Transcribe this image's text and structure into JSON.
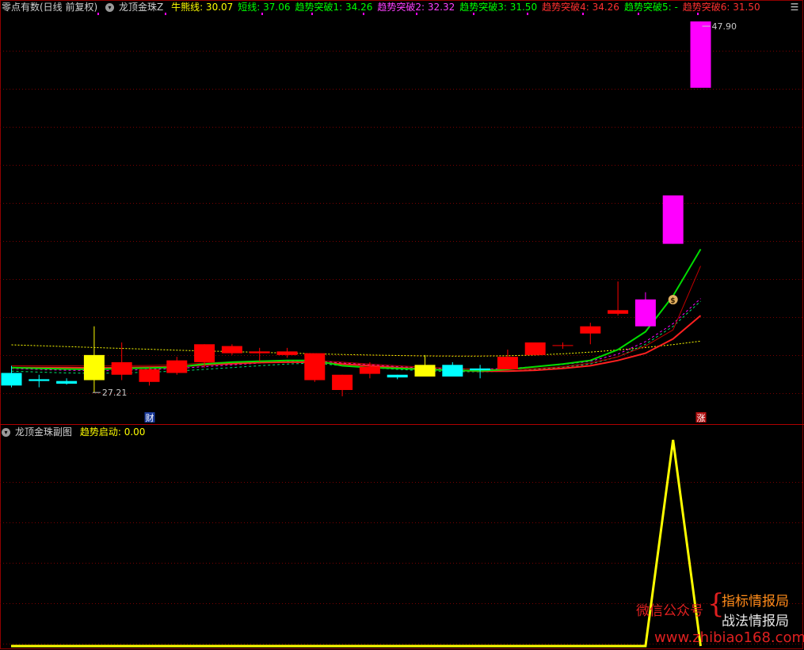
{
  "header": {
    "title": "零点有数(日线 前复权)",
    "indicator_name": "龙顶金珠Z",
    "items": [
      {
        "label": "牛熊线",
        "value": "30.07",
        "color": "#ffff00"
      },
      {
        "label": "短线",
        "value": "37.06",
        "color": "#00ff00"
      },
      {
        "label": "趋势突破1",
        "value": "34.26",
        "color": "#00ff00"
      },
      {
        "label": "趋势突破2",
        "value": "32.32",
        "color": "#ff40ff"
      },
      {
        "label": "趋势突破3",
        "value": "31.50",
        "color": "#00ff00"
      },
      {
        "label": "趋势突破4",
        "value": "34.26",
        "color": "#ff3030"
      },
      {
        "label": "趋势突破5",
        "value": "-",
        "color": "#00ff00"
      },
      {
        "label": "趋势突破6",
        "value": "31.50",
        "color": "#ff3030"
      }
    ]
  },
  "subpanel": {
    "indicator_name": "龙顶金珠副图",
    "items": [
      {
        "label": "趋势启动",
        "value": "0.00",
        "color": "#ffff00"
      }
    ]
  },
  "price_labels": {
    "high": "47.90",
    "low": "27.21"
  },
  "markers": {
    "finance": "财",
    "limit_up": "涨",
    "money": "$"
  },
  "watermark": {
    "left": "微信公众号",
    "right_top": "指标情报局",
    "right_bottom": "战法情报局",
    "url": "www.zhibiao168.com"
  },
  "colors": {
    "up": "#ff0000",
    "down": "#00ffff",
    "flat_yellow": "#ffff00",
    "magenta": "#ff00ff",
    "grid": "#7a0000",
    "bull_bear_line": "#ffff00",
    "short_line": "#00ff00"
  },
  "chart_data": {
    "type": "candlestick",
    "candles": [
      {
        "o": 28.3,
        "h": 28.7,
        "l": 27.5,
        "c": 27.6,
        "color": "cyan"
      },
      {
        "o": 27.95,
        "h": 28.2,
        "l": 27.5,
        "c": 27.85,
        "color": "cyan"
      },
      {
        "o": 27.85,
        "h": 28.0,
        "l": 27.65,
        "c": 27.7,
        "color": "cyan"
      },
      {
        "o": 27.9,
        "h": 30.9,
        "l": 27.21,
        "c": 29.3,
        "color": "yellow"
      },
      {
        "o": 28.2,
        "h": 30.0,
        "l": 27.9,
        "c": 28.9,
        "color": "red"
      },
      {
        "o": 27.8,
        "h": 28.6,
        "l": 27.6,
        "c": 28.5,
        "color": "red"
      },
      {
        "o": 28.3,
        "h": 29.2,
        "l": 28.2,
        "c": 29.0,
        "color": "red"
      },
      {
        "o": 28.9,
        "h": 29.9,
        "l": 28.6,
        "c": 29.9,
        "color": "red"
      },
      {
        "o": 29.4,
        "h": 29.9,
        "l": 29.3,
        "c": 29.8,
        "color": "red"
      },
      {
        "o": 29.4,
        "h": 29.7,
        "l": 28.95,
        "c": 29.5,
        "color": "red"
      },
      {
        "o": 29.3,
        "h": 29.7,
        "l": 29.15,
        "c": 29.5,
        "color": "red"
      },
      {
        "o": 27.9,
        "h": 29.3,
        "l": 27.8,
        "c": 29.4,
        "color": "red"
      },
      {
        "o": 27.35,
        "h": 28.2,
        "l": 27.0,
        "c": 28.2,
        "color": "red"
      },
      {
        "o": 28.25,
        "h": 28.9,
        "l": 28.0,
        "c": 28.65,
        "color": "red"
      },
      {
        "o": 28.2,
        "h": 28.2,
        "l": 27.95,
        "c": 28.05,
        "color": "cyan"
      },
      {
        "o": 28.75,
        "h": 29.3,
        "l": 28.2,
        "c": 28.1,
        "color": "yellow"
      },
      {
        "o": 28.1,
        "h": 28.9,
        "l": 28.1,
        "c": 28.75,
        "color": "cyan"
      },
      {
        "o": 28.55,
        "h": 28.75,
        "l": 28.0,
        "c": 28.45,
        "color": "cyan"
      },
      {
        "o": 28.5,
        "h": 29.6,
        "l": 28.5,
        "c": 29.2,
        "color": "red"
      },
      {
        "o": 29.3,
        "h": 30.0,
        "l": 29.3,
        "c": 30.0,
        "color": "red"
      },
      {
        "o": 29.85,
        "h": 30.0,
        "l": 29.65,
        "c": 29.85,
        "color": "red"
      },
      {
        "o": 30.5,
        "h": 31.1,
        "l": 29.9,
        "c": 30.9,
        "color": "red"
      },
      {
        "o": 31.6,
        "h": 33.4,
        "l": 31.5,
        "c": 31.8,
        "color": "red"
      },
      {
        "o": 32.4,
        "h": 32.8,
        "l": 30.9,
        "c": 30.9,
        "color": "magenta"
      },
      {
        "o": 35.5,
        "h": 36.3,
        "l": 35.5,
        "c": 38.2,
        "color": "magenta"
      },
      {
        "o": 47.9,
        "h": 47.9,
        "l": 45.6,
        "c": 44.2,
        "color": "magenta"
      }
    ],
    "price_ylim": [
      26.2,
      48.3
    ],
    "bull_bear_line": [
      29.87,
      29.82,
      29.77,
      29.72,
      29.67,
      29.62,
      29.57,
      29.53,
      29.49,
      29.45,
      29.41,
      29.37,
      29.33,
      29.3,
      29.27,
      29.25,
      29.24,
      29.24,
      29.26,
      29.3,
      29.37,
      29.46,
      29.58,
      29.72,
      29.88,
      30.07
    ],
    "short_line": [
      28.6,
      28.55,
      28.52,
      28.5,
      28.55,
      28.58,
      28.62,
      28.8,
      28.9,
      28.95,
      29.0,
      29.0,
      28.7,
      28.6,
      28.55,
      28.5,
      28.45,
      28.42,
      28.5,
      28.65,
      28.8,
      29.0,
      29.6,
      30.6,
      32.6,
      35.2
    ],
    "trend2": [
      28.4,
      28.35,
      28.3,
      28.28,
      28.3,
      28.35,
      28.4,
      28.5,
      28.6,
      28.7,
      28.8,
      28.85,
      28.7,
      28.6,
      28.5,
      28.42,
      28.38,
      28.36,
      28.4,
      28.5,
      28.62,
      28.8,
      29.2,
      29.9,
      30.9,
      32.3
    ],
    "trend4": [
      28.7,
      28.7,
      28.7,
      28.68,
      28.7,
      28.72,
      28.75,
      28.85,
      28.92,
      28.98,
      29.0,
      29.0,
      28.9,
      28.8,
      28.7,
      28.62,
      28.55,
      28.5,
      28.5,
      28.55,
      28.65,
      28.85,
      29.2,
      29.8,
      30.7,
      34.26
    ],
    "trend6": [
      28.6,
      28.6,
      28.6,
      28.58,
      28.6,
      28.62,
      28.65,
      28.75,
      28.82,
      28.88,
      28.9,
      28.9,
      28.8,
      28.7,
      28.6,
      28.52,
      28.45,
      28.4,
      28.4,
      28.45,
      28.55,
      28.7,
      29.0,
      29.4,
      30.2,
      31.5
    ],
    "sub_signal": [
      0,
      0,
      0,
      0,
      0,
      0,
      0,
      0,
      0,
      0,
      0,
      0,
      0,
      0,
      0,
      0,
      0,
      0,
      0,
      0,
      0,
      0,
      0,
      0,
      1,
      0
    ],
    "sub_ylim": [
      0,
      1
    ]
  }
}
